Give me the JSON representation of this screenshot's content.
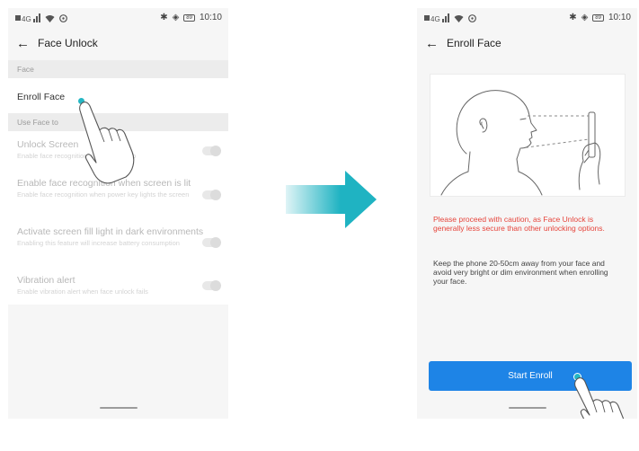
{
  "status_bar": {
    "network": "4G",
    "time": "10:10",
    "battery": "89"
  },
  "left_screen": {
    "title": "Face Unlock",
    "section_face": "Face",
    "enroll_face": "Enroll Face",
    "section_use_face_to": "Use Face to",
    "settings": [
      {
        "title": "Unlock Screen",
        "subtitle": "Enable face recognition when sliding up",
        "enabled": false
      },
      {
        "title": "Enable face recognition when screen is lit",
        "subtitle": "Enable face recognition when power key lights the screen",
        "enabled": false
      },
      {
        "title": "Activate screen fill light in dark environments",
        "subtitle": "Enabling this feature will increase battery consumption",
        "enabled": false
      },
      {
        "title": "Vibration alert",
        "subtitle": "Enable vibration alert when face unlock fails",
        "enabled": false
      }
    ]
  },
  "right_screen": {
    "title": "Enroll Face",
    "caution": "Please proceed with caution, as Face Unlock is generally less secure than other unlocking options.",
    "instructions": "Keep the phone 20-50cm away from your face and avoid very bright or dim environment when enrolling your face.",
    "start_button": "Start Enroll"
  },
  "colors": {
    "accent_blue": "#1e84e6",
    "tap_dot": "#25b7c4",
    "caution_red": "#e6453c",
    "arrow_teal": "#1fb3c2"
  },
  "icons": [
    "signal-icon",
    "wifi-icon",
    "vpn-icon",
    "bluetooth-icon",
    "alarm-icon",
    "battery-icon",
    "back-arrow-icon",
    "tap-hand-icon",
    "right-arrow-icon"
  ]
}
